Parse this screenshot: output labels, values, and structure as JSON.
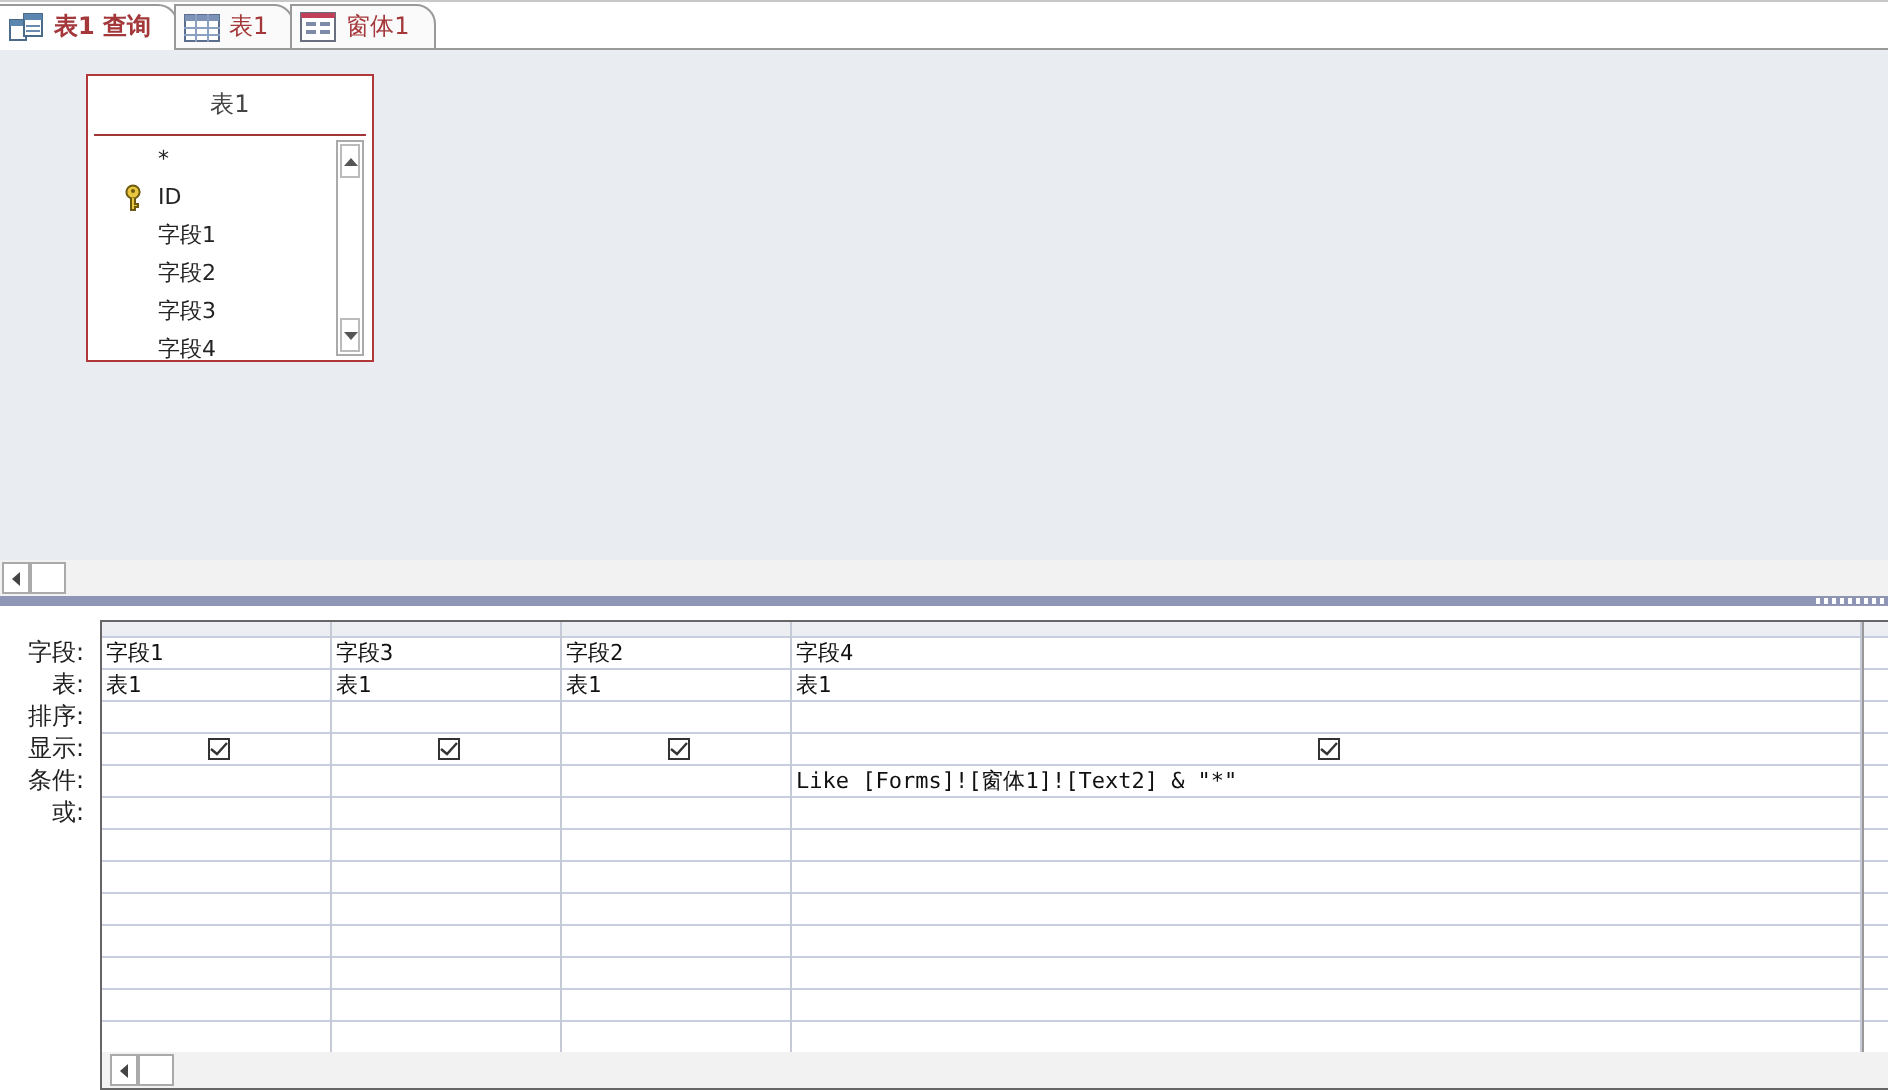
{
  "tabs": [
    {
      "label": "表1 查询",
      "kind": "query",
      "selected": true
    },
    {
      "label": "表1",
      "kind": "table",
      "selected": false
    },
    {
      "label": "窗体1",
      "kind": "form",
      "selected": false
    }
  ],
  "field_list": {
    "title": "表1",
    "fields": [
      {
        "name": "*",
        "primary_key": false
      },
      {
        "name": "ID",
        "primary_key": true
      },
      {
        "name": "字段1",
        "primary_key": false
      },
      {
        "name": "字段2",
        "primary_key": false
      },
      {
        "name": "字段3",
        "primary_key": false
      },
      {
        "name": "字段4",
        "primary_key": false
      }
    ]
  },
  "grid": {
    "row_labels": [
      "字段:",
      "表:",
      "排序:",
      "显示:",
      "条件:",
      "或:"
    ],
    "columns": [
      {
        "field": "字段1",
        "table": "表1",
        "show": true
      },
      {
        "field": "字段3",
        "table": "表1",
        "show": true
      },
      {
        "field": "字段2",
        "table": "表1",
        "show": true
      },
      {
        "field": "字段4",
        "table": "表1",
        "show": true,
        "criteria": "Like [Forms]![窗体1]![Text2] & \"*\""
      }
    ]
  }
}
